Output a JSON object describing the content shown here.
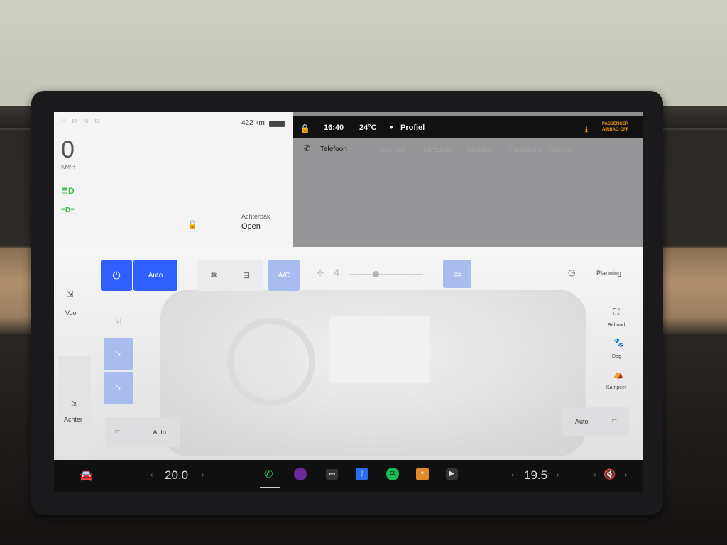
{
  "gear": "P R N D",
  "speed": {
    "value": "0",
    "unit": "KM/H"
  },
  "range": "422 km",
  "trunk": {
    "label": "Achterbak",
    "value": "Open"
  },
  "topbar": {
    "time": "16:40",
    "temp": "24°C",
    "profile": "Profiel",
    "airbag": "PASSENGER AIRBAG OFF"
  },
  "phone": {
    "title": "Telefoon",
    "tabs": [
      "Gesprek",
      "Contacten",
      "Berichten",
      "Favorieten",
      "Agenda"
    ]
  },
  "climate": {
    "auto": "Auto",
    "ac": "A/C",
    "fan": "4",
    "planning": "Planning",
    "front": "Voor",
    "rear": "Achter",
    "seat_auto_left": "Auto",
    "seat_auto_right": "Auto",
    "modes": [
      "Behoud",
      "Dog",
      "Kampeer"
    ]
  },
  "bottom": {
    "left_temp": "20.0",
    "right_temp": "19.5"
  },
  "colors": {
    "accent": "#2f5fff",
    "green": "#36c24b"
  }
}
